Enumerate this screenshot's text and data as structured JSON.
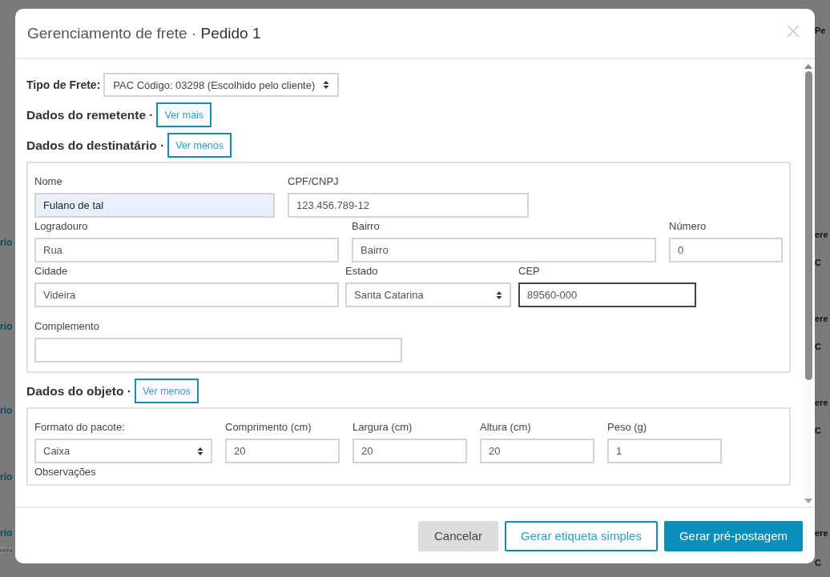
{
  "background": {
    "left": [
      "rio",
      "rio",
      "rio",
      "rio",
      "rio",
      "neira"
    ],
    "right": [
      "Pe",
      "ere",
      "C",
      "ere",
      "C",
      "ere",
      "C",
      "ere",
      "C"
    ]
  },
  "modal": {
    "title": "Gerenciamento de frete ·",
    "order": "Pedido 1"
  },
  "freight_type": {
    "label": "Tipo de Frete:",
    "value": "PAC Código: 03298 (Escolhido pelo cliente)"
  },
  "sections": [
    {
      "title": "Dados do remetente ·",
      "toggle": "Ver mais"
    },
    {
      "title": "Dados do destinatário ·",
      "toggle": "Ver menos",
      "rows": [
        [
          {
            "label": "Nome",
            "value": "Fulano de tal",
            "kind": "input",
            "autofilled": true,
            "focused": false
          },
          {
            "label": "CPF/CNPJ",
            "value": "123.456.789-12",
            "kind": "input",
            "autofilled": false,
            "focused": false
          }
        ],
        [
          {
            "label": "Logradouro",
            "value": "Rua",
            "kind": "input",
            "autofilled": false,
            "focused": false
          },
          {
            "label": "Bairro",
            "value": "Bairro",
            "kind": "input",
            "autofilled": false,
            "focused": false
          },
          {
            "label": "Número",
            "value": "0",
            "kind": "input",
            "autofilled": false,
            "focused": false
          }
        ],
        [
          {
            "label": "Cidade",
            "value": "Videira",
            "kind": "input",
            "autofilled": false,
            "focused": false
          },
          {
            "label": "Estado",
            "value": "Santa Catarina",
            "kind": "select",
            "autofilled": false,
            "focused": false
          },
          {
            "label": "CEP",
            "value": "89560-000",
            "kind": "input",
            "autofilled": false,
            "focused": true
          }
        ],
        [
          {
            "label": "Complemento",
            "kind": "input",
            "autofilled": false,
            "focused": false
          }
        ]
      ]
    },
    {
      "title": "Dados do objeto ·",
      "toggle": "Ver menos",
      "rows": [
        [
          {
            "label": "Formato do pacote:",
            "value": "Caixa",
            "kind": "select",
            "autofilled": false,
            "focused": false
          },
          {
            "label": "Comprimento (cm)",
            "value": "20",
            "kind": "input",
            "autofilled": false,
            "focused": false
          },
          {
            "label": "Largura (cm)",
            "value": "20",
            "kind": "input",
            "autofilled": false,
            "focused": false
          },
          {
            "label": "Altura (cm)",
            "value": "20",
            "kind": "input",
            "autofilled": false,
            "focused": false
          },
          {
            "label": "Peso (g)",
            "value": "1",
            "kind": "input",
            "autofilled": false,
            "focused": false
          }
        ]
      ],
      "trailing_label": "Observações"
    }
  ],
  "buttons": [
    {
      "label": "Cancelar",
      "kind": "secondary"
    },
    {
      "label": "Gerar etiqueta simples",
      "kind": "outline"
    },
    {
      "label": "Gerar pré-postagem",
      "kind": "primary"
    }
  ]
}
